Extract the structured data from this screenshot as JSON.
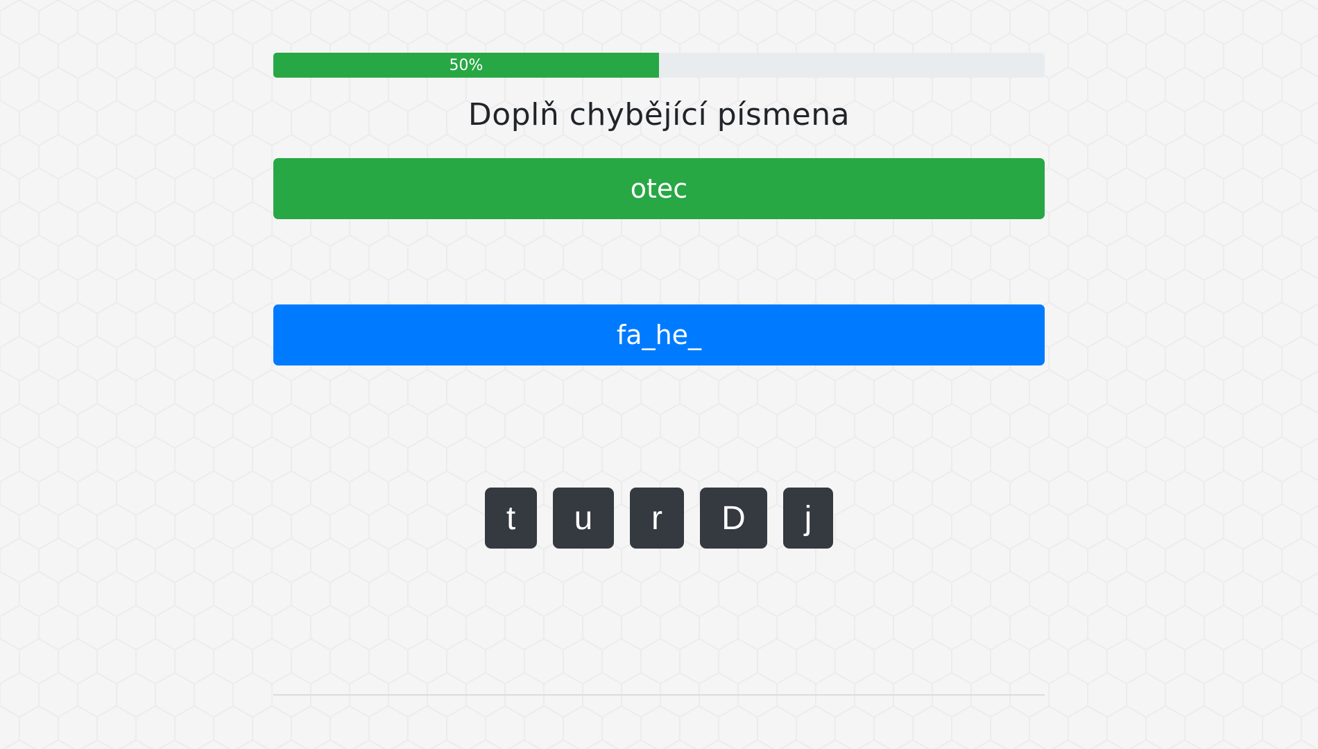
{
  "progress": {
    "percent": 50,
    "label": "50%",
    "fill_color": "#28a745",
    "track_color": "#e9ecef"
  },
  "exercise": {
    "instruction": "Doplň chybějící písmena"
  },
  "words": {
    "solved": "otec",
    "current": "fa_he_"
  },
  "letter_options": [
    "t",
    "u",
    "r",
    "D",
    "j"
  ],
  "colors": {
    "solved_bg": "#28a745",
    "current_bg": "#007bff",
    "key_bg": "#343a40",
    "page_bg": "#f5f5f5"
  }
}
